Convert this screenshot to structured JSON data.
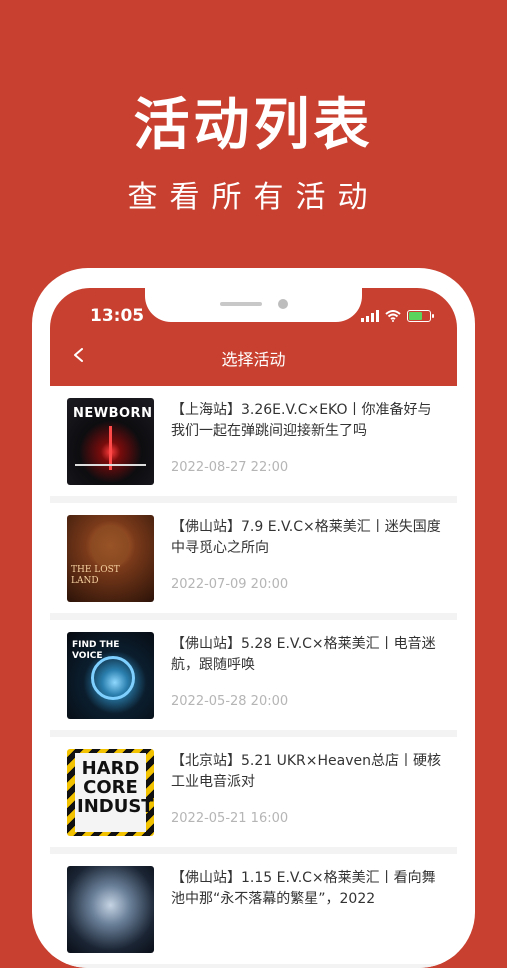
{
  "hero": {
    "title": "活动列表",
    "subtitle": "查看所有活动"
  },
  "status_bar": {
    "time": "13:05"
  },
  "nav": {
    "title": "选择活动"
  },
  "events": [
    {
      "title": "【上海站】3.26E.V.C×EKO丨你准备好与我们一起在弹跳间迎接新生了吗",
      "date": "2022-08-27 22:00",
      "poster_text": "NEWBORN"
    },
    {
      "title": "【佛山站】7.9 E.V.C×格莱美汇丨迷失国度中寻觅心之所向",
      "date": "2022-07-09 20:00",
      "poster_text": "THE LOST LAND"
    },
    {
      "title": "【佛山站】5.28 E.V.C×格莱美汇丨电音迷航，跟随呼唤",
      "date": "2022-05-28 20:00",
      "poster_text": "FIND THE VOICE"
    },
    {
      "title": "【北京站】5.21 UKR×Heaven总店丨硬核工业电音派对",
      "date": "2022-05-21 16:00",
      "poster_text": "HARD CORE INDUSTRY"
    },
    {
      "title": "【佛山站】1.15 E.V.C×格莱美汇丨看向舞池中那“永不落幕的繁星”，2022",
      "date": ""
    }
  ]
}
